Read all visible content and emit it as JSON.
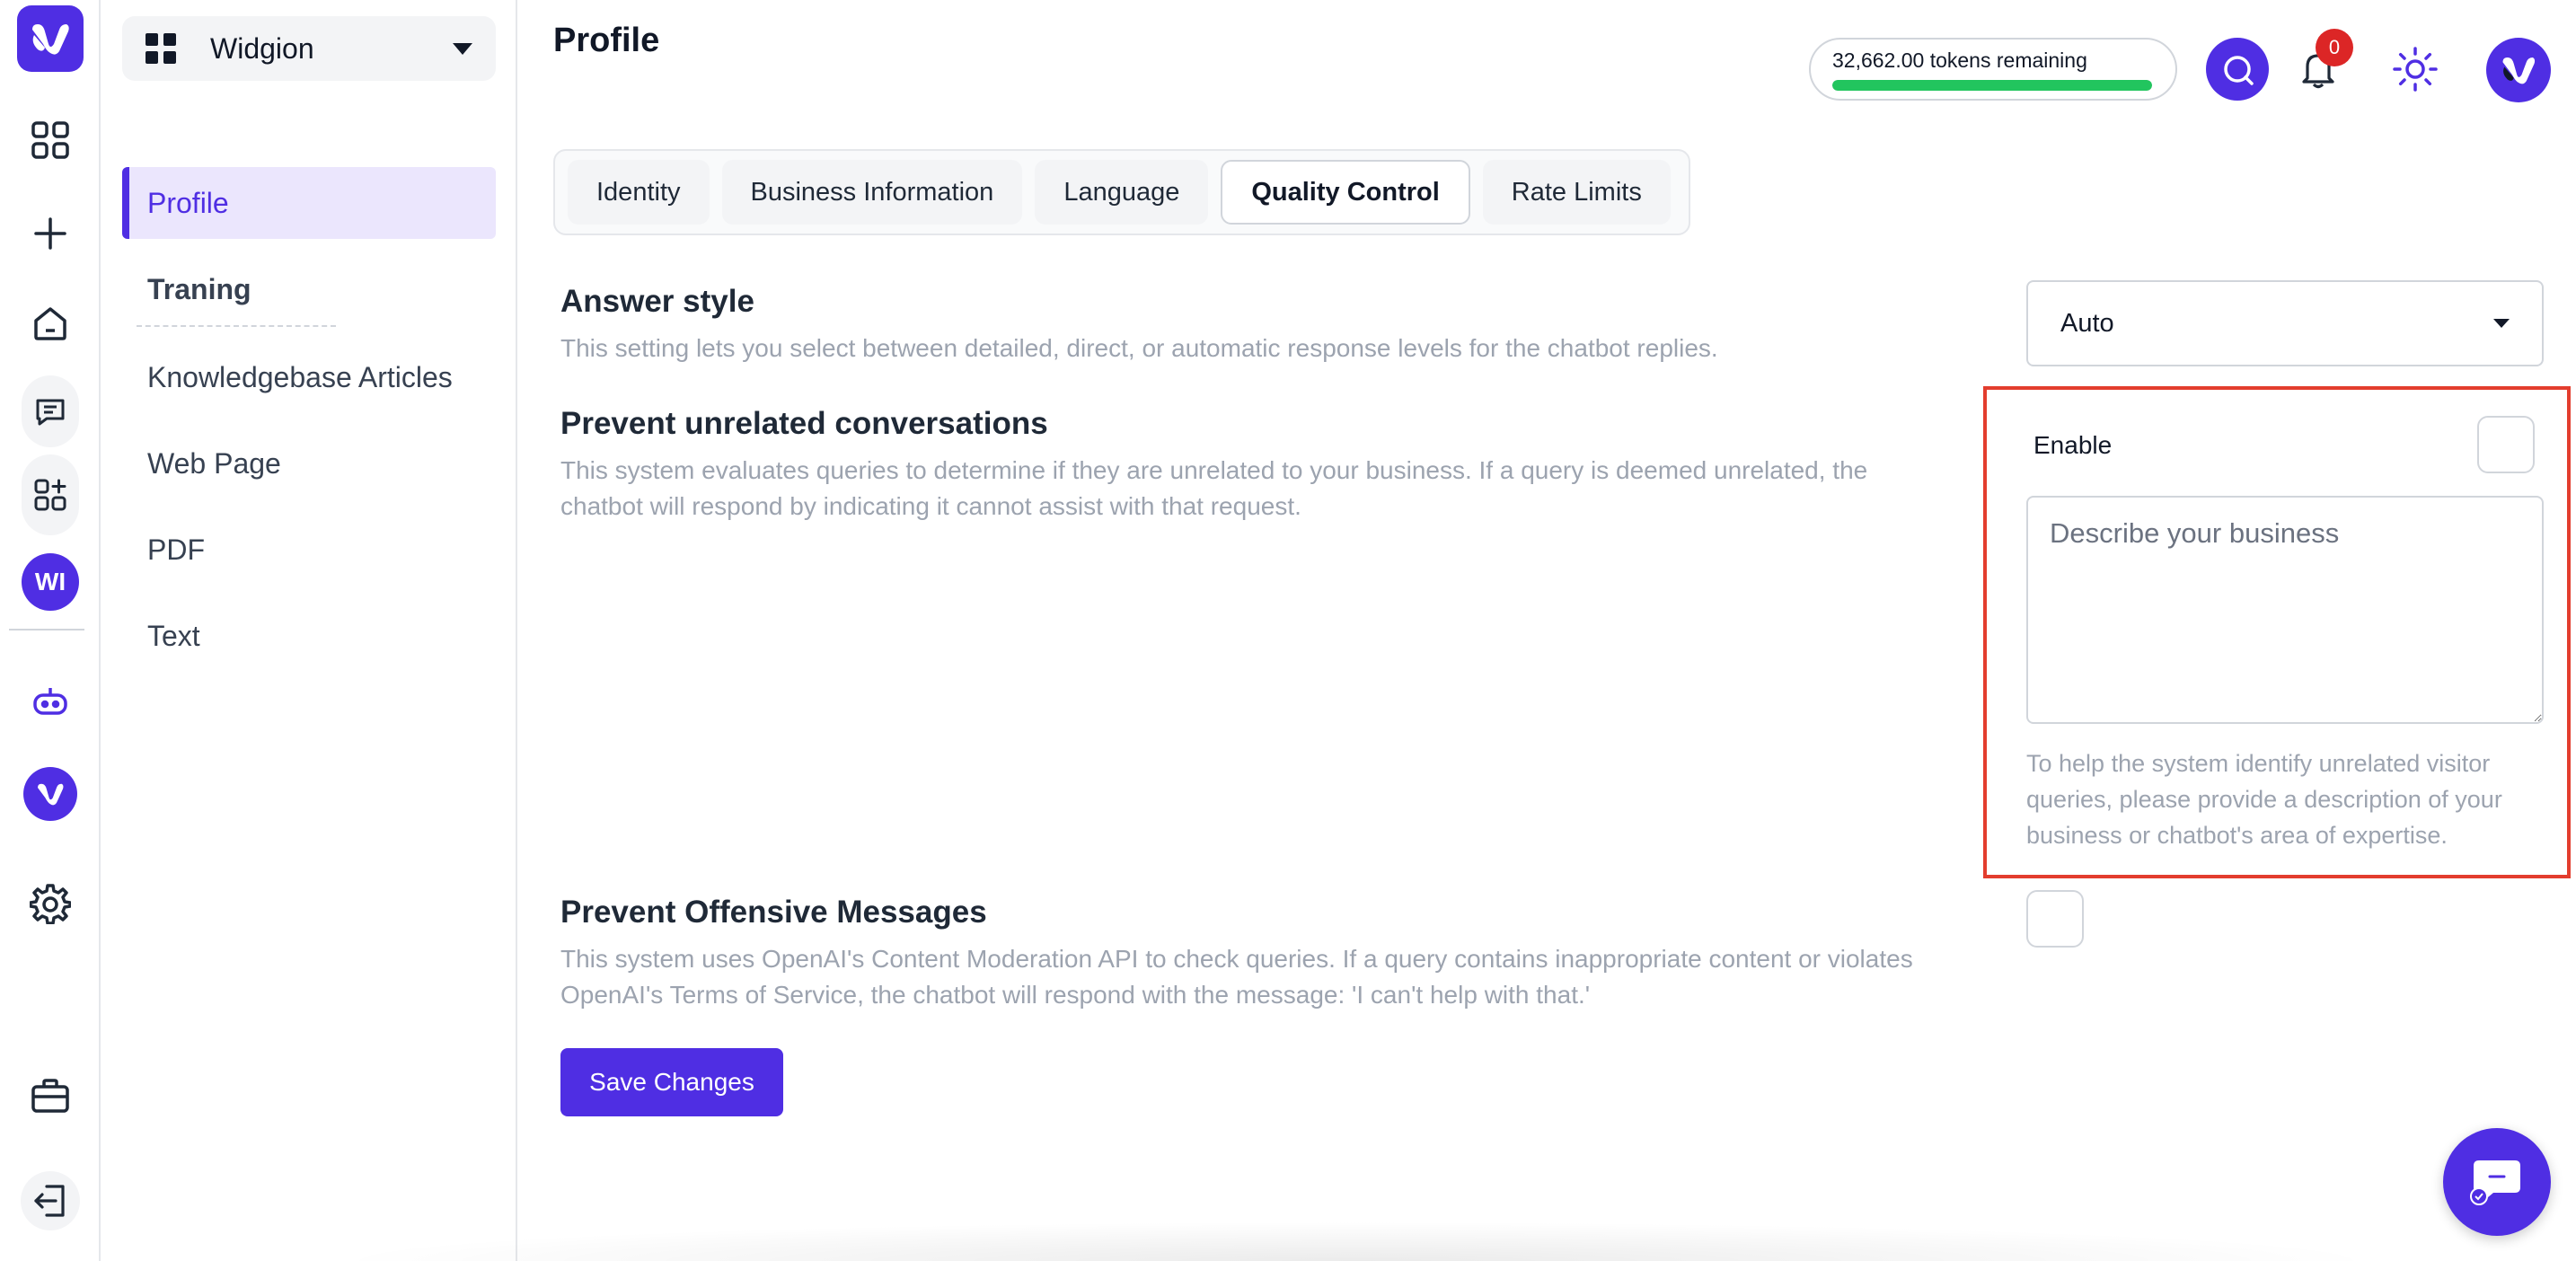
{
  "app": {
    "workspace_name": "Widgion",
    "page_title": "Profile"
  },
  "rail": {
    "avatar_initials": "WI",
    "icons": [
      "logo-icon",
      "dashboard-icon",
      "plus-icon",
      "home-icon",
      "chat-icon",
      "apps-icon",
      "bot-icon",
      "brand-icon",
      "gear-icon",
      "briefcase-icon",
      "logout-icon"
    ]
  },
  "subnav": {
    "items": [
      {
        "label": "Profile",
        "active": true
      },
      {
        "label": "Traning",
        "section": true
      },
      {
        "label": "Knowledgebase Articles"
      },
      {
        "label": "Web Page"
      },
      {
        "label": "PDF"
      },
      {
        "label": "Text"
      }
    ]
  },
  "header": {
    "tokens_text": "32,662.00 tokens remaining",
    "tokens_progress_pct": 100,
    "notification_count": "0"
  },
  "tabs": [
    {
      "label": "Identity"
    },
    {
      "label": "Business Information"
    },
    {
      "label": "Language"
    },
    {
      "label": "Quality Control",
      "active": true
    },
    {
      "label": "Rate Limits"
    }
  ],
  "answer_style": {
    "title": "Answer style",
    "description": "This setting lets you select between detailed, direct, or automatic response levels for the chatbot replies.",
    "selected": "Auto"
  },
  "unrelated": {
    "title": "Prevent unrelated conversations",
    "description_line1": "This system evaluates queries to determine if they are unrelated to your business. If a query is deemed unrelated, the",
    "description_line2": "chatbot will respond by indicating it cannot assist with that request.",
    "enable_label": "Enable",
    "enabled": false,
    "textarea_placeholder": "Describe your business",
    "helper_text": "To help the system identify unrelated visitor queries, please provide a description of your business or chatbot's area of expertise."
  },
  "offensive": {
    "title": "Prevent Offensive Messages",
    "description_line1": "This system uses OpenAI's Content Moderation API to check queries. If a query contains inappropriate content or violates",
    "description_line2": "OpenAI's Terms of Service, the chatbot will respond with the message: 'I can't help with that.'",
    "enabled": false
  },
  "actions": {
    "save_label": "Save Changes"
  },
  "colors": {
    "brand": "#4f2ee3",
    "highlight": "#e33d2e",
    "progress": "#22c55e",
    "badge": "#dc2626"
  }
}
